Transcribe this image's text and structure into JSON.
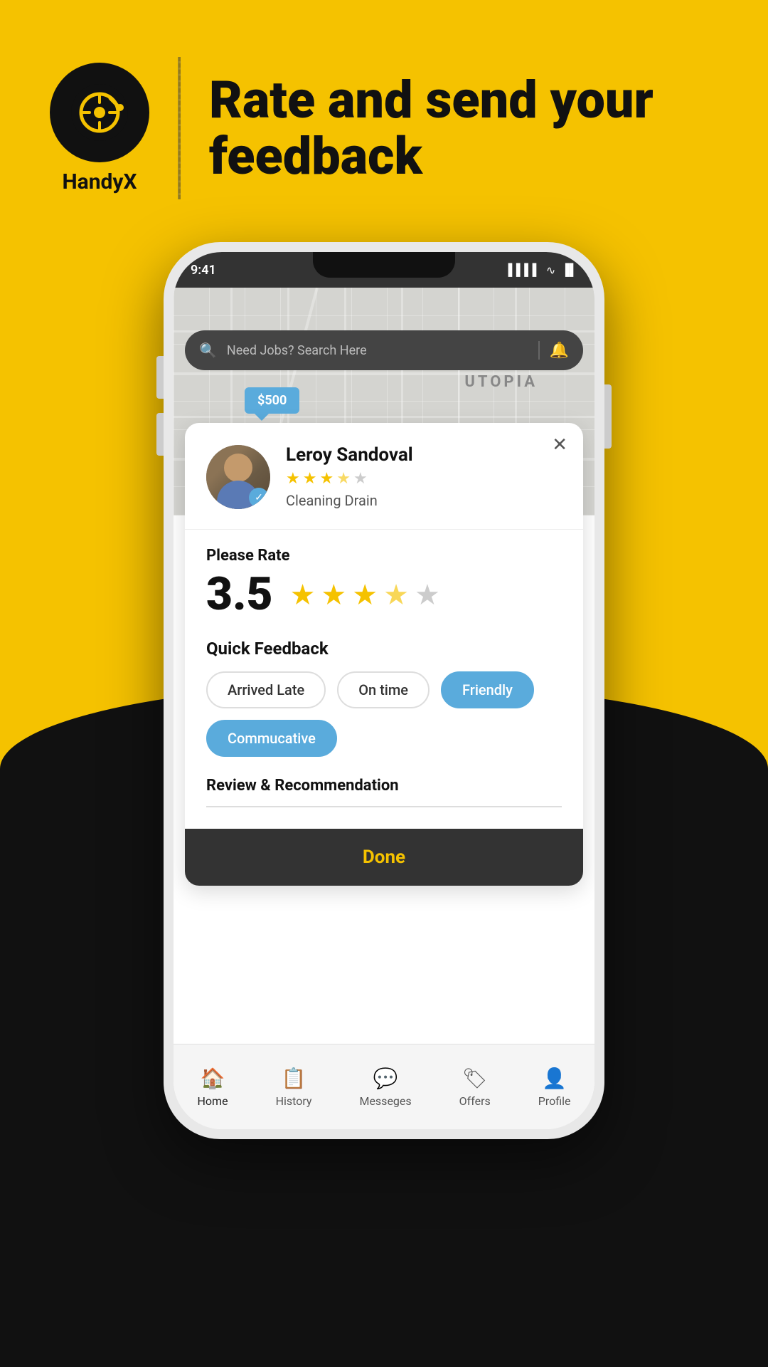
{
  "app": {
    "name": "HandyX",
    "tagline": "Rate and send your feedback"
  },
  "header": {
    "search_placeholder": "Need Jobs? Search Here"
  },
  "price_pin": "$500",
  "map": {
    "area_label": "UTOPIA"
  },
  "modal": {
    "professional": {
      "name": "Leroy Sandoval",
      "service": "Cleaning Drain",
      "rating": "3.5",
      "stars": [
        {
          "type": "filled"
        },
        {
          "type": "filled"
        },
        {
          "type": "filled"
        },
        {
          "type": "half"
        },
        {
          "type": "empty"
        }
      ]
    },
    "rate_section": {
      "label": "Please Rate",
      "value": "3.5",
      "stars": [
        {
          "type": "filled"
        },
        {
          "type": "filled"
        },
        {
          "type": "filled"
        },
        {
          "type": "half"
        },
        {
          "type": "empty"
        }
      ]
    },
    "quick_feedback": {
      "label": "Quick Feedback",
      "tags": [
        {
          "label": "Arrived Late",
          "style": "outline"
        },
        {
          "label": "On time",
          "style": "outline"
        },
        {
          "label": "Friendly",
          "style": "filled-blue"
        },
        {
          "label": "Commucative",
          "style": "filled-blue"
        }
      ]
    },
    "review": {
      "label": "Review & Recommendation",
      "placeholder": ""
    },
    "done_button": "Done"
  },
  "bottom_nav": {
    "items": [
      {
        "icon": "🏠",
        "label": "Home",
        "active": true
      },
      {
        "icon": "📋",
        "label": "History",
        "active": false
      },
      {
        "icon": "💬",
        "label": "Messeges",
        "active": false
      },
      {
        "icon": "🏷",
        "label": "Offers",
        "active": false
      },
      {
        "icon": "👤",
        "label": "Profile",
        "active": false
      }
    ]
  },
  "status_bar": {
    "signal": "▌▌▌▌",
    "wifi": "WiFi",
    "battery": "🔋"
  }
}
